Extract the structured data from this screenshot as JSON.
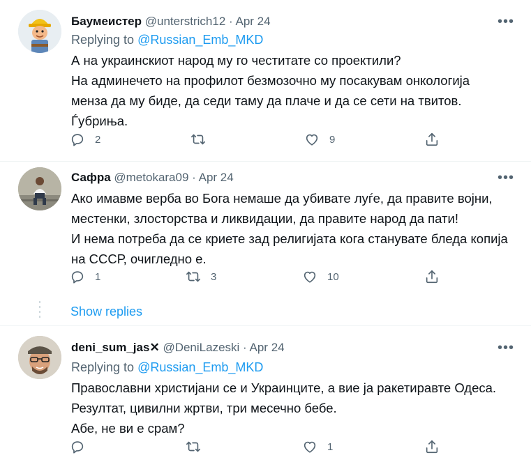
{
  "tweets": [
    {
      "display_name": "Баумеистер",
      "handle": "@unterstrich12",
      "separator": "·",
      "date": "Apr 24",
      "replying_prefix": "Replying to",
      "replying_handle": "@Russian_Emb_MKD",
      "lines": [
        "А на украинскиот народ му го честитате со проектили?",
        "На админечето на профилот безмозочно му посакувам онкологија",
        "менза да му биде, да седи таму да плаче и да се сети на твитов.",
        "Ѓубриња."
      ],
      "replies": "2",
      "retweets": "",
      "likes": "9"
    },
    {
      "display_name": "Сафра",
      "handle": "@metokara09",
      "separator": "·",
      "date": "Apr 24",
      "lines": [
        "Ако имавме верба во Бога немаше да убивате луѓе, да правите војни,",
        "местенки, злосторства и ликвидации, да правите народ да пати!",
        "И нема потреба да се криете зад религијата кога станувате бледа копија",
        "на СССР, очигледно е."
      ],
      "replies": "1",
      "retweets": "3",
      "likes": "10"
    },
    {
      "display_name": "deni_sum_jas",
      "name_emoji": "✕",
      "handle": "@DeniLazeski",
      "separator": "·",
      "date": "Apr 24",
      "replying_prefix": "Replying to",
      "replying_handle": "@Russian_Emb_MKD",
      "lines": [
        "Православни христијани се и Украинците, а вие ја ракетиравте Одеса.",
        "Резултат, цивилни жртви, три месечно бебе.",
        "Абе, не ви е срам?"
      ],
      "replies": "",
      "retweets": "",
      "likes": "1"
    }
  ],
  "show_replies_label": "Show replies",
  "more_label": "•••",
  "colors": {
    "link": "#1d9bf0",
    "secondary": "#536471",
    "divider": "#eff3f4"
  },
  "icons": [
    "reply-icon",
    "retweet-icon",
    "like-icon",
    "share-icon",
    "more-icon"
  ]
}
